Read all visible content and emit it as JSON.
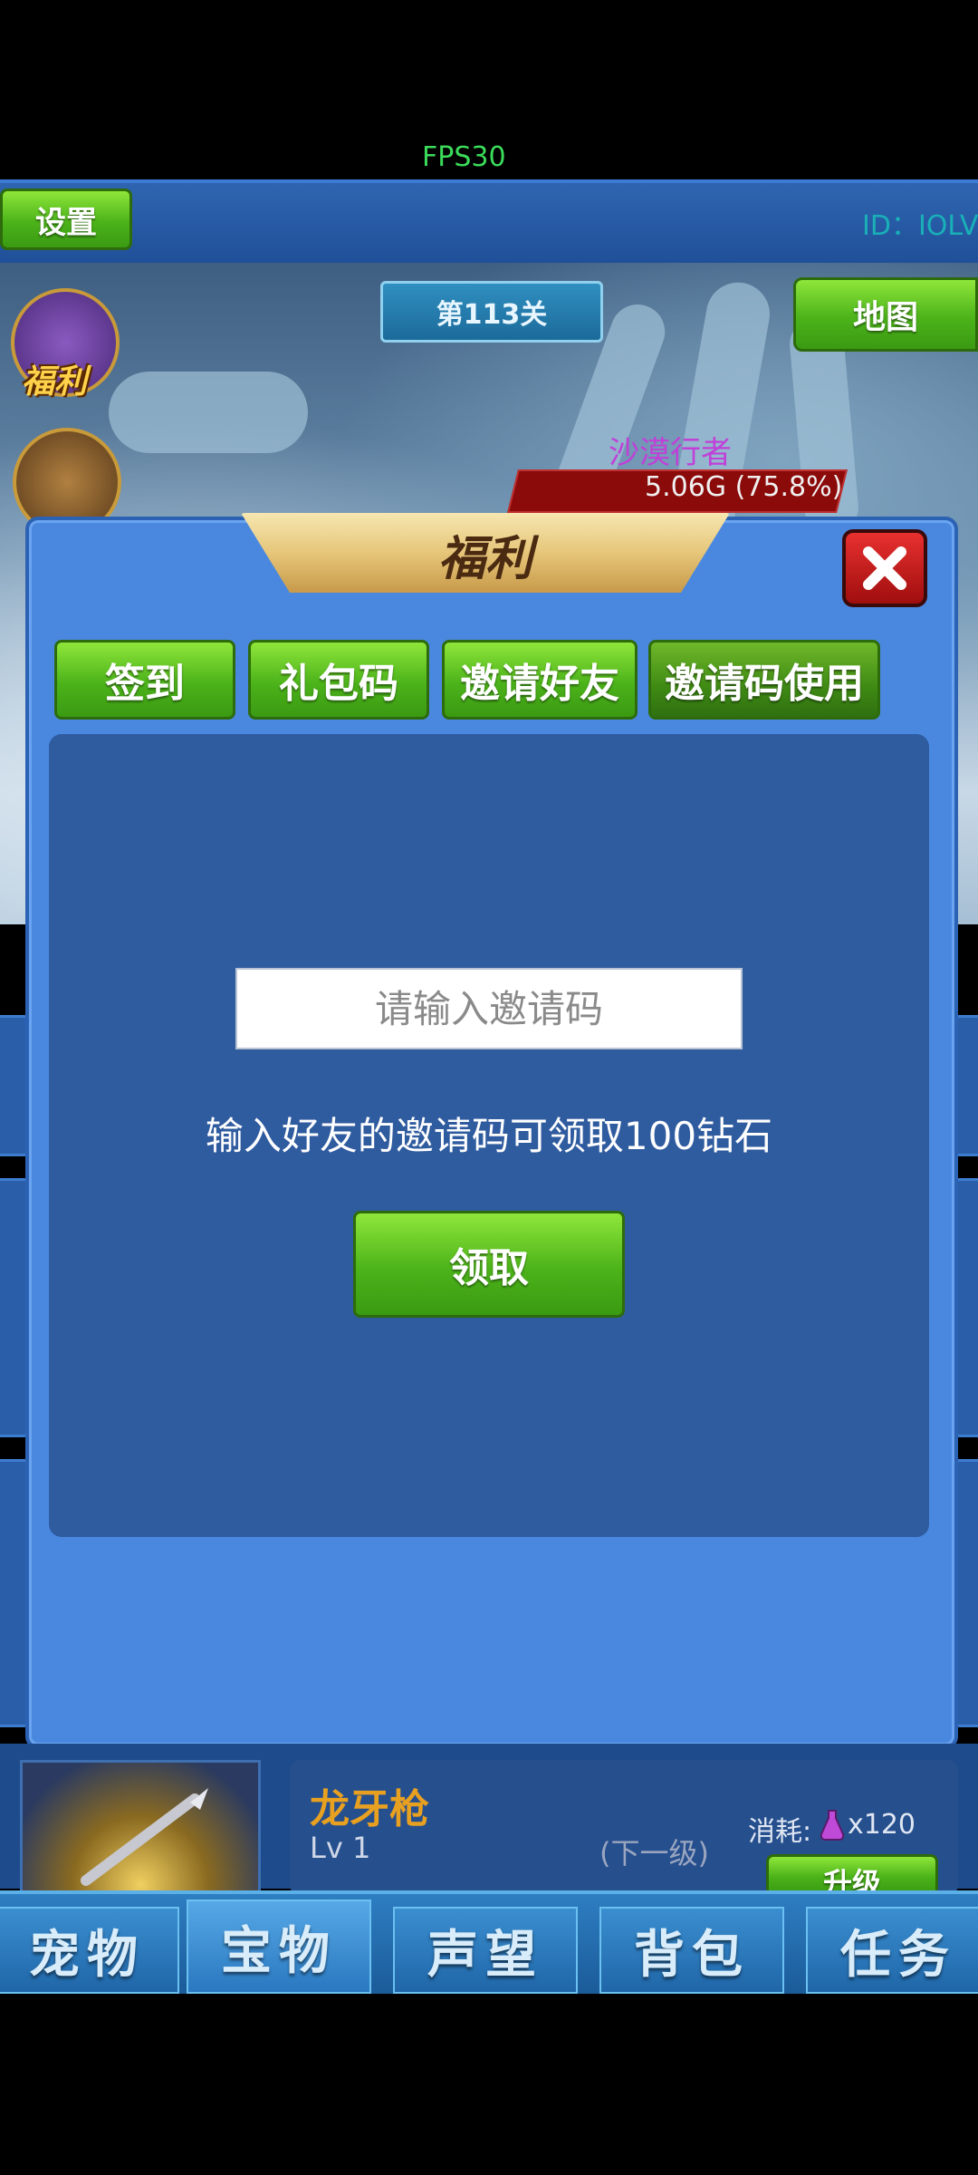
{
  "status": {
    "fps": "FPS30"
  },
  "topbar": {
    "settings_label": "设置",
    "user_id": "ID：IOLV"
  },
  "scene": {
    "level_label": "第113关",
    "map_label": "地图",
    "welfare_label": "福利",
    "enemy_name": "沙漠行者",
    "enemy_hp_text": "5.06G (75.8%)",
    "enemy_hp_fraction": 0.758
  },
  "dialog": {
    "title": "福利",
    "tabs": [
      {
        "label": "签到"
      },
      {
        "label": "礼包码"
      },
      {
        "label": "邀请好友"
      },
      {
        "label": "邀请码使用"
      }
    ],
    "active_tab": "邀请码使用",
    "input_placeholder": "请输入邀请码",
    "input_value": "",
    "hint": "输入好友的邀请码可领取100钻石",
    "claim_label": "领取"
  },
  "item": {
    "name": "龙牙枪",
    "level": "Lv 1",
    "next_label": "(下一级)",
    "cost_label": "消耗:",
    "cost_value": "x120",
    "upgrade_label": "升级"
  },
  "nav": {
    "tabs": [
      {
        "label": "宠物"
      },
      {
        "label": "宝物"
      },
      {
        "label": "声望"
      },
      {
        "label": "背包"
      },
      {
        "label": "任务"
      }
    ],
    "active": "宝物"
  },
  "colors": {
    "dialog_bg": "#4a88e0",
    "panel_bg": "#2f5b9f",
    "button_green": "#6fd22a",
    "enemy_name": "#c040d8",
    "item_name": "#e8a020"
  }
}
